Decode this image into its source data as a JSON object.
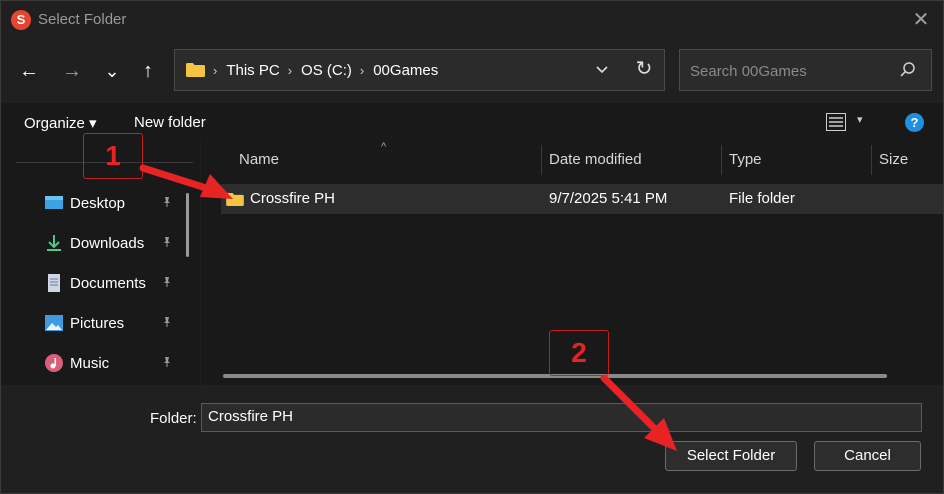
{
  "window": {
    "title": "Select Folder",
    "app_icon_letter": "S",
    "close_glyph": "✕"
  },
  "nav_buttons": {
    "back": "←",
    "forward": "→",
    "recent": "⌄",
    "up": "↑"
  },
  "address": {
    "crumbs": [
      "This PC",
      "OS (C:)",
      "00Games"
    ],
    "separator": "›",
    "dropdown": "⌄",
    "refresh": "↻"
  },
  "search": {
    "placeholder": "Search 00Games",
    "icon": "search-icon"
  },
  "command_bar": {
    "organize_label": "Organize ▾",
    "new_folder_label": "New folder",
    "view_dropdown": "▾",
    "help": "?"
  },
  "nav_pane": {
    "items": [
      {
        "label": "Desktop",
        "icon": "desktop-icon"
      },
      {
        "label": "Downloads",
        "icon": "downloads-icon"
      },
      {
        "label": "Documents",
        "icon": "documents-icon"
      },
      {
        "label": "Pictures",
        "icon": "pictures-icon"
      },
      {
        "label": "Music",
        "icon": "music-icon"
      }
    ],
    "pin_glyph": "📌"
  },
  "file_list": {
    "columns": [
      "Name",
      "Date modified",
      "Type",
      "Size"
    ],
    "sort_glyph": "^",
    "rows": [
      {
        "name": "Crossfire PH",
        "date_modified": "9/7/2025 5:41 PM",
        "type": "File folder",
        "size": ""
      }
    ]
  },
  "footer": {
    "folder_label": "Folder:",
    "folder_value": "Crossfire PH",
    "select_button": "Select Folder",
    "cancel_button": "Cancel"
  },
  "annotations": {
    "step1": "1",
    "step2": "2",
    "color": "#e82323"
  },
  "colors": {
    "background": "#202020",
    "pane": "#191919",
    "selected_row": "#2d2d2d",
    "folder_yellow": "#f5c542",
    "help_blue": "#1e8fe1"
  }
}
